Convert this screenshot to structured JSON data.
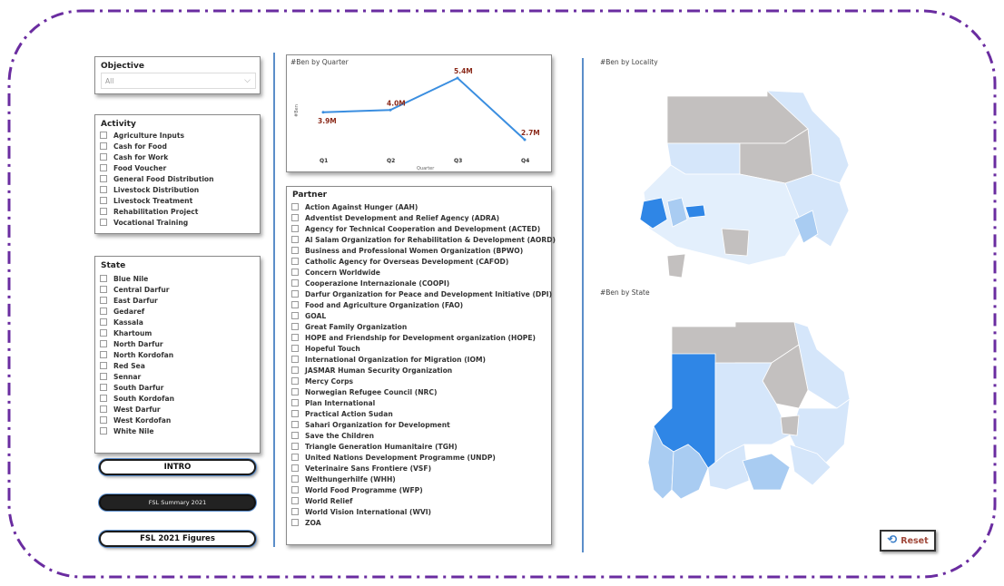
{
  "objective": {
    "title": "Objective",
    "selected": "All"
  },
  "activity": {
    "title": "Activity",
    "items": [
      "Agriculture Inputs",
      "Cash for Food",
      "Cash for Work",
      "Food Voucher",
      "General Food Distribution",
      "Livestock Distribution",
      "Livestock Treatment",
      "Rehabilitation Project",
      "Vocational Training"
    ]
  },
  "state": {
    "title": "State",
    "items": [
      "Blue Nile",
      "Central Darfur",
      "East Darfur",
      "Gedaref",
      "Kassala",
      "Khartoum",
      "North Darfur",
      "North Kordofan",
      "Red Sea",
      "Sennar",
      "South Darfur",
      "South Kordofan",
      "West Darfur",
      "West Kordofan",
      "White Nile"
    ]
  },
  "partner": {
    "title": "Partner",
    "items": [
      "Action Against Hunger (AAH)",
      "Adventist Development and Relief Agency (ADRA)",
      "Agency for Technical Cooperation and Development (ACTED)",
      "Al Salam Organization for Rehabilitation & Development (AORD)",
      "Business and Professional Women Organization (BPWO)",
      "Catholic Agency for Overseas Development (CAFOD)",
      "Concern Worldwide",
      "Cooperazione Internazionale (COOPI)",
      "Darfur Organization for Peace and Development Initiative (DPI)",
      "Food and Agriculture Organization (FAO)",
      "GOAL",
      "Great Family Organization",
      "HOPE and Friendship for Development organization (HOPE)",
      "Hopeful Touch",
      "International Organization for Migration (IOM)",
      "JASMAR Human Security Organization",
      "Mercy Corps",
      "Norwegian Refugee Council (NRC)",
      "Plan International",
      "Practical Action Sudan",
      "Sahari Organization for Development",
      "Save the Children",
      "Triangle Generation Humanitaire (TGH)",
      "United Nations Development Programme (UNDP)",
      "Veterinaire Sans Frontiere (VSF)",
      "Welthungerhilfe (WHH)",
      "World Food Programme (WFP)",
      "World Relief",
      "World Vision International (WVI)",
      "ZOA"
    ]
  },
  "buttons": {
    "intro": "INTRO",
    "summary": "FSL Summary 2021",
    "figures": "FSL 2021 Figures",
    "reset": "Reset"
  },
  "maps": {
    "locality_title": "#Ben by Locality",
    "state_title": "#Ben by State"
  },
  "chart_data": {
    "type": "line",
    "title": "#Ben by Quarter",
    "xlabel": "Quarter",
    "ylabel": "#Ben",
    "categories": [
      "Q1",
      "Q2",
      "Q3",
      "Q4"
    ],
    "values": [
      3.9,
      4.0,
      5.4,
      2.7
    ],
    "labels": [
      "3.9M",
      "4.0M",
      "5.4M",
      "2.7M"
    ],
    "ylim": [
      2.5,
      5.6
    ],
    "series_color": "#3a8ee0",
    "label_color": "#8b2a1a"
  },
  "colors": {
    "frame": "#6a2ca0",
    "divider": "#5b8ec9",
    "map_light": "#d5e6fa",
    "map_mid": "#a9ccf2",
    "map_dark": "#2f86e6",
    "map_none": "#c3c0bf"
  }
}
